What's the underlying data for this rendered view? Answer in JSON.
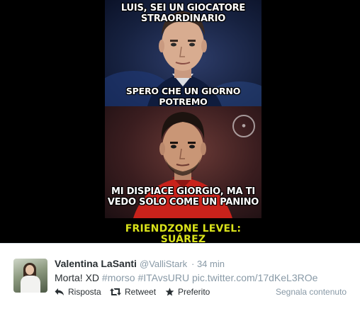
{
  "meme": {
    "caption_top": "Luis, sei un giocatore\nstraordinario",
    "caption_middle": "Spero che un giorno potremo\ngiocare in squadra insieme",
    "caption_bottom": "Mi dispiace Giorgio, ma ti\nvedo solo come un panino",
    "caption_level": "Friendzone level: Suárez",
    "colors": {
      "caption": "#ffffff",
      "level_caption": "#d9e21a",
      "frame": "#000000"
    }
  },
  "tweet": {
    "author_name": "Valentina LaSanti",
    "author_handle": "@ValliStark",
    "time": "· 34 min",
    "text_plain": "Morta! XD",
    "hashtag_1": "#morso",
    "hashtag_2": "#ITAvsURU",
    "link": "pic.twitter.com/17dKeL3ROe",
    "actions": {
      "reply": "Risposta",
      "retweet": "Retweet",
      "favorite": "Preferito"
    },
    "report": "Segnala contenuto",
    "icons": [
      "reply-icon",
      "retweet-icon",
      "favorite-icon"
    ],
    "colors": {
      "name": "#292f33",
      "muted": "#8899a6",
      "text": "#292f33"
    }
  }
}
